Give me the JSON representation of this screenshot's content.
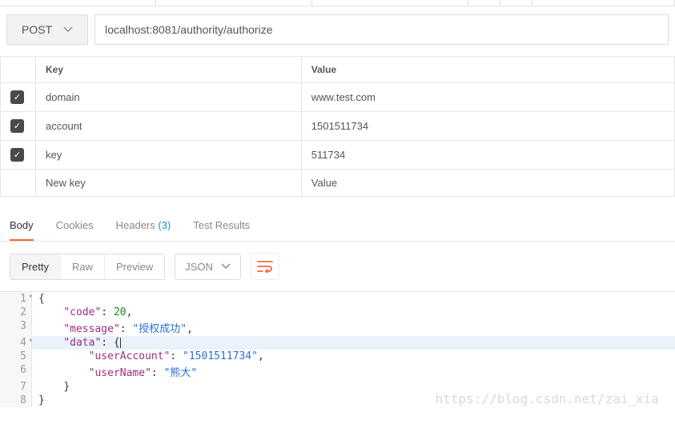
{
  "request": {
    "method": "POST",
    "url": "localhost:8081/authority/authorize"
  },
  "params": {
    "headers": {
      "key": "Key",
      "value": "Value"
    },
    "rows": [
      {
        "enabled": true,
        "key": "domain",
        "value": "www.test.com"
      },
      {
        "enabled": true,
        "key": "account",
        "value": "1501511734"
      },
      {
        "enabled": true,
        "key": "key",
        "value": "511734"
      }
    ],
    "placeholder": {
      "key": "New key",
      "value": "Value"
    }
  },
  "response_tabs": {
    "body": "Body",
    "cookies": "Cookies",
    "headers": "Headers",
    "headers_count": "(3)",
    "tests": "Test Results"
  },
  "formatting": {
    "pretty": "Pretty",
    "raw": "Raw",
    "preview": "Preview",
    "type": "JSON"
  },
  "body_lines": [
    {
      "n": "1",
      "fold": true
    },
    {
      "n": "2",
      "k": "code",
      "num": "20",
      "comma": true
    },
    {
      "n": "3",
      "k": "message",
      "str": "授权成功",
      "comma": true
    },
    {
      "n": "4",
      "k": "data",
      "fold": true,
      "hl": true
    },
    {
      "n": "5",
      "k": "userAccount",
      "str": "1501511734",
      "comma": true,
      "indent": 2
    },
    {
      "n": "6",
      "k": "userName",
      "str": "熊大",
      "indent": 2
    },
    {
      "n": "7"
    },
    {
      "n": "8"
    }
  ],
  "watermark": "https://blog.csdn.net/zai_xia"
}
